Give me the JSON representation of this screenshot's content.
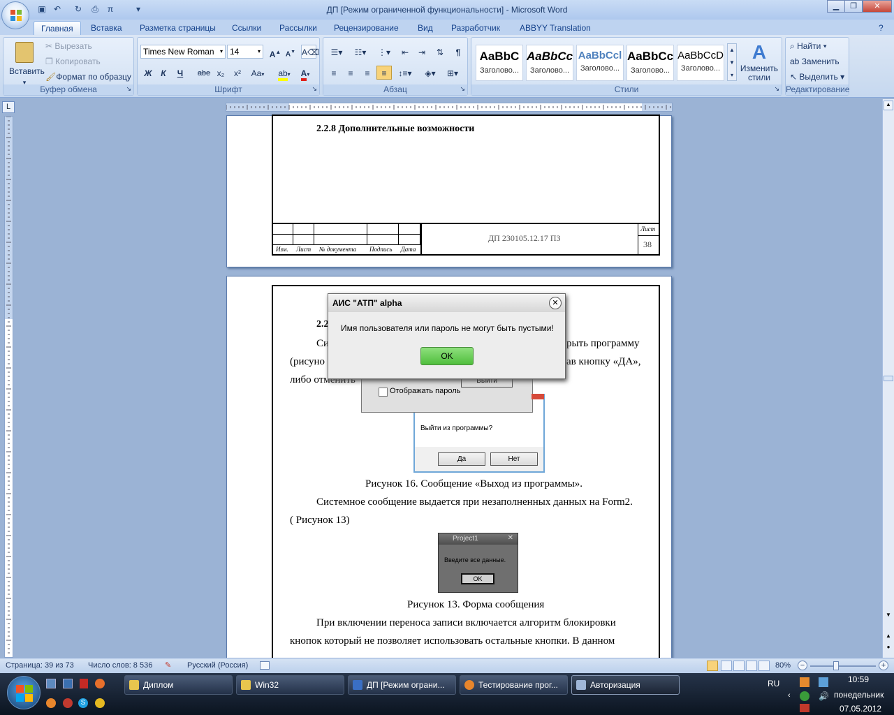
{
  "window": {
    "title": "ДП [Режим ограниченной функциональности] - Microsoft Word",
    "minimize": "▁",
    "maximize": "❐",
    "close": "✕"
  },
  "tabs": [
    "Главная",
    "Вставка",
    "Разметка страницы",
    "Ссылки",
    "Рассылки",
    "Рецензирование",
    "Вид",
    "Разработчик",
    "ABBYY Translation"
  ],
  "clipboard": {
    "paste": "Вставить",
    "cut": "Вырезать",
    "copy": "Копировать",
    "format_painter": "Формат по образцу",
    "label": "Буфер обмена"
  },
  "font": {
    "name": "Times New Roman",
    "size": "14",
    "label": "Шрифт",
    "bold": "Ж",
    "italic": "К",
    "underline": "Ч",
    "strike": "abe",
    "subscript": "x₂",
    "superscript": "x²",
    "case": "Aa"
  },
  "paragraph": {
    "label": "Абзац"
  },
  "styles": {
    "label": "Стили",
    "cards": [
      {
        "sample": "AaBbC",
        "name": "Заголово..."
      },
      {
        "sample": "AaBbCc",
        "name": "Заголово..."
      },
      {
        "sample": "AaBbCcl",
        "name": "Заголово..."
      },
      {
        "sample": "AaBbCc",
        "name": "Заголово..."
      },
      {
        "sample": "AaBbCcD",
        "name": "Заголово..."
      }
    ],
    "change": "Изменить стили"
  },
  "editing": {
    "label": "Редактирование",
    "find": "Найти",
    "replace": "Заменить",
    "select": "Выделить"
  },
  "page1": {
    "heading": "2.2.8 Дополнительные возможности",
    "stamp_code": "ДП 230105.12.17 ПЗ",
    "stamp_sheet_label": "Лист",
    "stamp_sheet_num": "38",
    "stamp_cols": [
      "Изм.",
      "Лист",
      "№ документа",
      "Подпись",
      "Дата"
    ]
  },
  "page2": {
    "line1_left": "2.2",
    "line2_left": "Си",
    "line2_right": "рыть программу",
    "line3_left": "(рисуно",
    "line3_right": "ав кнопку «ДА»,",
    "line4_left": "либо отменить",
    "caption16": "Рисунок 16. Сообщение «Выход из программы».",
    "para_sys": "Системное сообщение выдается при незаполненных данных на Form2.",
    "para_ref": "( Рисунок 13)",
    "caption13": "Рисунок 13. Форма сообщения",
    "para_last1": "При   включении   переноса   записи   включается   алгоритм   блокировки",
    "para_last2": "кнопок   который   не   позволяет   использовать   остальные   кнопки.   В   данном"
  },
  "fig_exit": {
    "question": "Выйти из программы?",
    "yes": "Да",
    "no": "Нет"
  },
  "fig_login": {
    "exit_btn": "Выйти",
    "show_password": "Отображать пароль"
  },
  "fig_project": {
    "title": "Project1",
    "message": "Введите все данные.",
    "ok": "OK"
  },
  "alert": {
    "title": "АИС \"АТП\" alpha",
    "message": "Имя пользователя или пароль не могут быть пустыми!",
    "ok": "OK"
  },
  "status": {
    "page": "Страница: 39 из 73",
    "words": "Число слов: 8 536",
    "lang": "Русский (Россия)",
    "zoom": "80%"
  },
  "taskbar": {
    "items": [
      "Диплом",
      "Win32",
      "ДП [Режим ограни...",
      "Тестирование прог...",
      "Авторизация"
    ],
    "lang": "RU",
    "time": "10:59",
    "day": "понедельник",
    "date": "07.05.2012"
  }
}
